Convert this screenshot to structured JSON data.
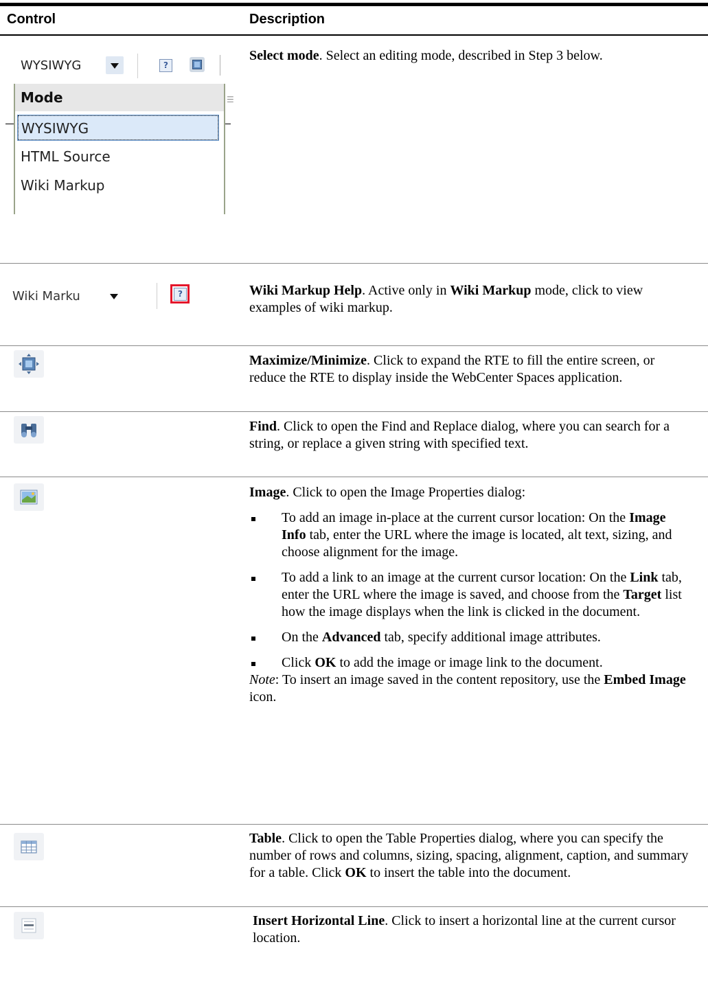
{
  "table": {
    "headers": {
      "control": "Control",
      "description": "Description"
    }
  },
  "mode_dropdown": {
    "selected": "WYSIWYG",
    "menu_header": "Mode",
    "options": [
      "WYSIWYG",
      "HTML Source",
      "Wiki Markup"
    ],
    "help_icon_glyph": "?"
  },
  "wiki_control": {
    "selected": "Wiki Marku",
    "help_icon_glyph": "?"
  },
  "rows": {
    "select_mode": {
      "title": "Select mode",
      "text": ". Select an editing mode, described in Step 3 below."
    },
    "wiki_help": {
      "title": "Wiki Markup Help",
      "t1": ". Active only in ",
      "b1": "Wiki Markup",
      "t2": " mode, click to view examples of wiki markup."
    },
    "maximize": {
      "title": "Maximize/Minimize",
      "text": ". Click to expand the RTE to fill the entire screen, or reduce the RTE to display inside the WebCenter Spaces application."
    },
    "find": {
      "title": "Find",
      "text": ". Click to open the Find and Replace dialog, where you can search for a string, or replace a given string with specified text."
    },
    "image": {
      "title": "Image",
      "text": ". Click to open the Image Properties dialog:",
      "b1": {
        "t1": "To add an image in-place at the current cursor location: On the ",
        "k": "Image Info",
        "t2": " tab, enter the URL where the image is located, alt text, sizing, and choose alignment for the image."
      },
      "b2": {
        "t1": "To add a link to an image at the current cursor location: On the ",
        "k1": "Link",
        "t2": " tab, enter the URL where the image is saved, and choose from the ",
        "k2": "Target",
        "t3": " list how the image displays when the link is clicked in the document."
      },
      "b3": {
        "t1": "On the ",
        "k": "Advanced",
        "t2": " tab, specify additional image attributes."
      },
      "b4": {
        "t1": "Click ",
        "k": "OK",
        "t2": " to add the image or image link to the document."
      },
      "note": {
        "label": "Note",
        "t1": ": To insert an image saved in the content repository, use the ",
        "k": "Embed Image",
        "t2": " icon."
      }
    },
    "table_row": {
      "title": "Table",
      "t1": ". Click to open the Table Properties dialog, where you can specify the number of rows and columns, sizing, spacing, alignment, caption, and summary for a table. Click ",
      "k": "OK",
      "t2": " to insert the table into the document."
    },
    "hline": {
      "title": "Insert Horizontal Line",
      "text": ". Click to insert a horizontal line at the current cursor location."
    }
  },
  "icons": {
    "maximize": "maximize-icon",
    "find": "binoculars-icon",
    "image": "image-icon",
    "table": "table-icon",
    "hline": "horizontal-line-icon"
  }
}
